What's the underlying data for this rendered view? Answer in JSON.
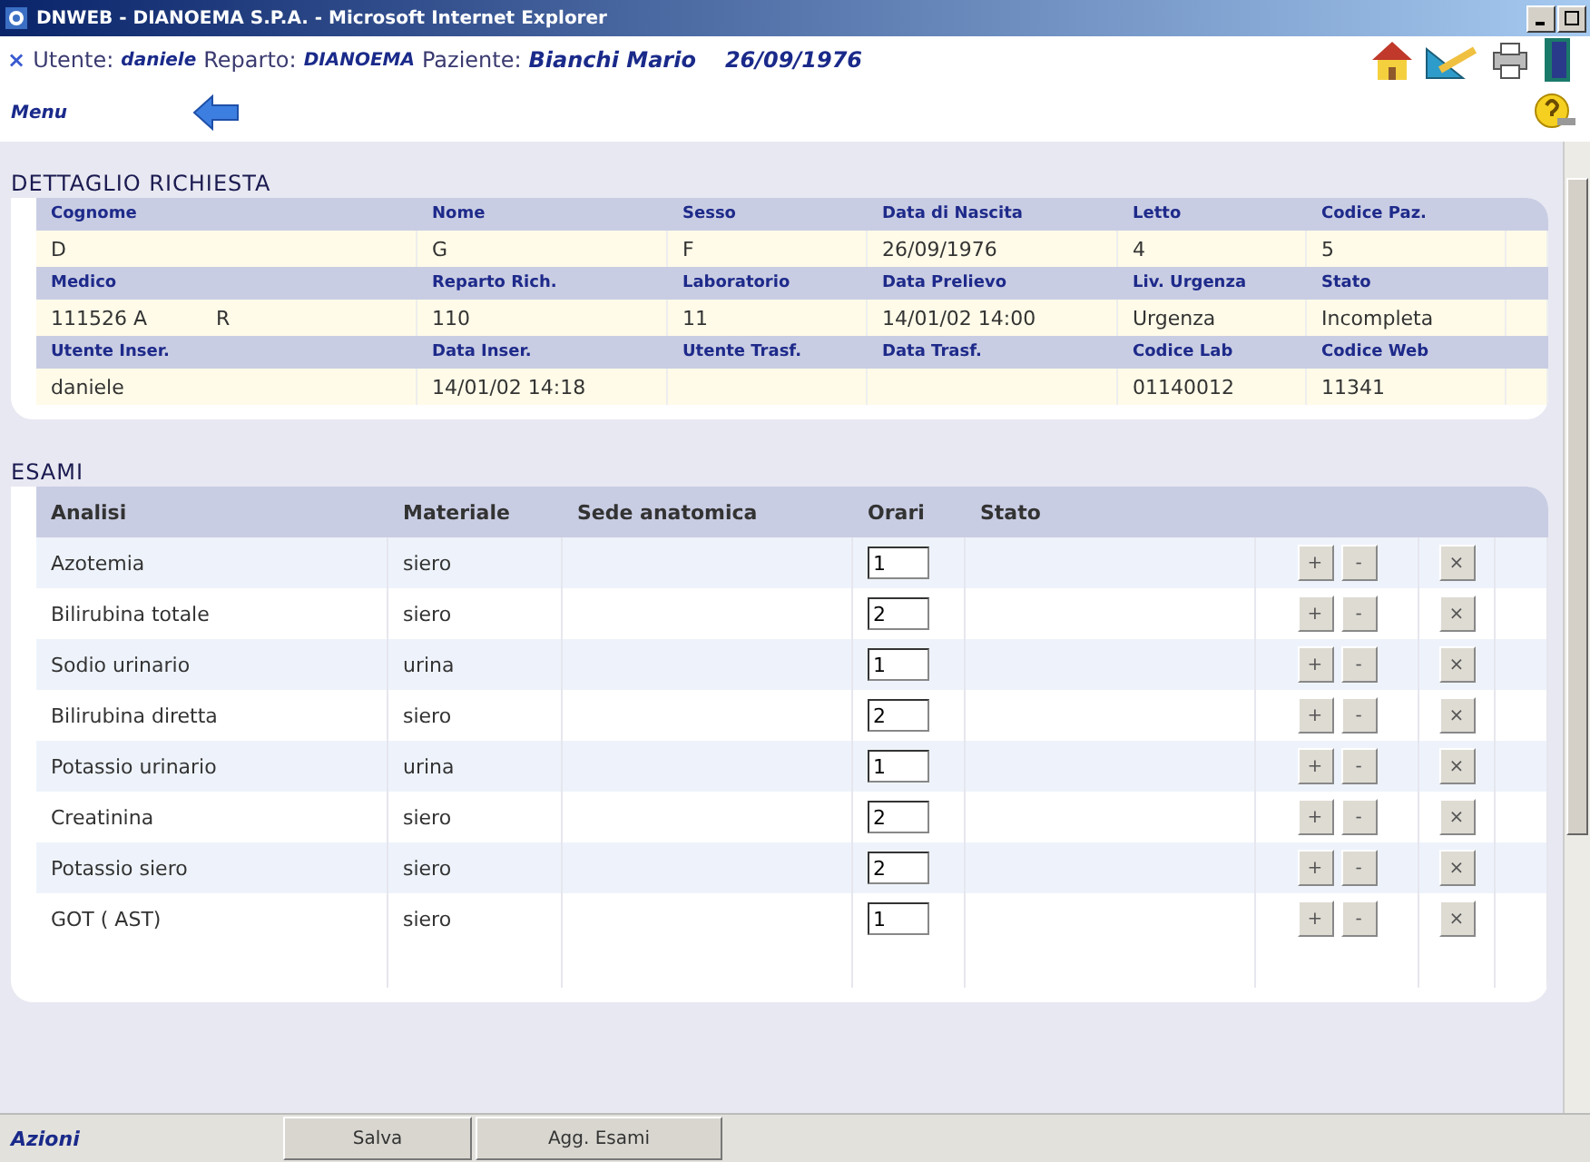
{
  "window": {
    "title": "DNWEB - DIANOEMA S.P.A. - Microsoft Internet Explorer"
  },
  "user_bar": {
    "close_mark": "×",
    "items": [
      {
        "label": "Utente:",
        "value": "daniele"
      },
      {
        "label": "Reparto:",
        "value": "DIANOEMA"
      },
      {
        "label": "Paziente:",
        "value": "Bianchi Mario"
      }
    ],
    "birth_date": "26/09/1976"
  },
  "nav": {
    "menu_label": "Menu"
  },
  "detail": {
    "title": "DETTAGLIO RICHIESTA",
    "rows": [
      {
        "cells": [
          {
            "label": "Cognome",
            "value": "D"
          },
          {
            "label": "Nome",
            "value": "G"
          },
          {
            "label": "Sesso",
            "value": "F"
          },
          {
            "label": "Data di Nascita",
            "value": "26/09/1976"
          },
          {
            "label": "Letto",
            "value": "4"
          },
          {
            "label": "Codice Paz.",
            "value": "5"
          }
        ]
      },
      {
        "cells": [
          {
            "label": "Medico",
            "value": "111526 A",
            "suffix": "R"
          },
          {
            "label": "Reparto Rich.",
            "value": "110"
          },
          {
            "label": "Laboratorio",
            "value": "11"
          },
          {
            "label": "Data Prelievo",
            "value": "14/01/02 14:00"
          },
          {
            "label": "Liv. Urgenza",
            "value": "Urgenza"
          },
          {
            "label": "Stato",
            "value": "Incompleta"
          }
        ]
      },
      {
        "cells": [
          {
            "label": "Utente Inser.",
            "value": "daniele"
          },
          {
            "label": "Data Inser.",
            "value": "14/01/02 14:18"
          },
          {
            "label": "Utente Trasf."
          },
          {
            "label": "Data Trasf."
          },
          {
            "label": "Codice Lab",
            "value": "01140012"
          },
          {
            "label": "Codice Web",
            "value": "11341"
          }
        ]
      }
    ]
  },
  "exams": {
    "title": "ESAMI",
    "columns": [
      "Analisi",
      "Materiale",
      "Sede anatomica",
      "Orari",
      "Stato"
    ],
    "rows": [
      {
        "analisi": "Azotemia",
        "materiale": "siero",
        "orari": "1",
        "buttons": [
          "+",
          "-",
          "×"
        ]
      },
      {
        "analisi": "Bilirubina totale",
        "materiale": "siero",
        "orari": "2",
        "buttons": [
          "+",
          "-",
          "×"
        ]
      },
      {
        "analisi": "Sodio urinario",
        "materiale": "urina",
        "orari": "1",
        "buttons": [
          "+",
          "-",
          "×"
        ]
      },
      {
        "analisi": "Bilirubina diretta",
        "materiale": "siero",
        "orari": "2",
        "buttons": [
          "+",
          "-",
          "×"
        ]
      },
      {
        "analisi": "Potassio urinario",
        "materiale": "urina",
        "orari": "1",
        "buttons": [
          "+",
          "-",
          "×"
        ]
      },
      {
        "analisi": "Creatinina",
        "materiale": "siero",
        "orari": "2",
        "buttons": [
          "+",
          "-",
          "×"
        ]
      },
      {
        "analisi": "Potassio siero",
        "materiale": "siero",
        "orari": "2",
        "buttons": [
          "+",
          "-",
          "×"
        ]
      },
      {
        "analisi": "GOT ( AST)",
        "materiale": "siero",
        "orari": "1",
        "buttons": [
          "+",
          "-",
          "×"
        ]
      }
    ]
  },
  "footer": {
    "label": "Azioni",
    "buttons": [
      "Salva",
      "Agg. Esami"
    ]
  }
}
